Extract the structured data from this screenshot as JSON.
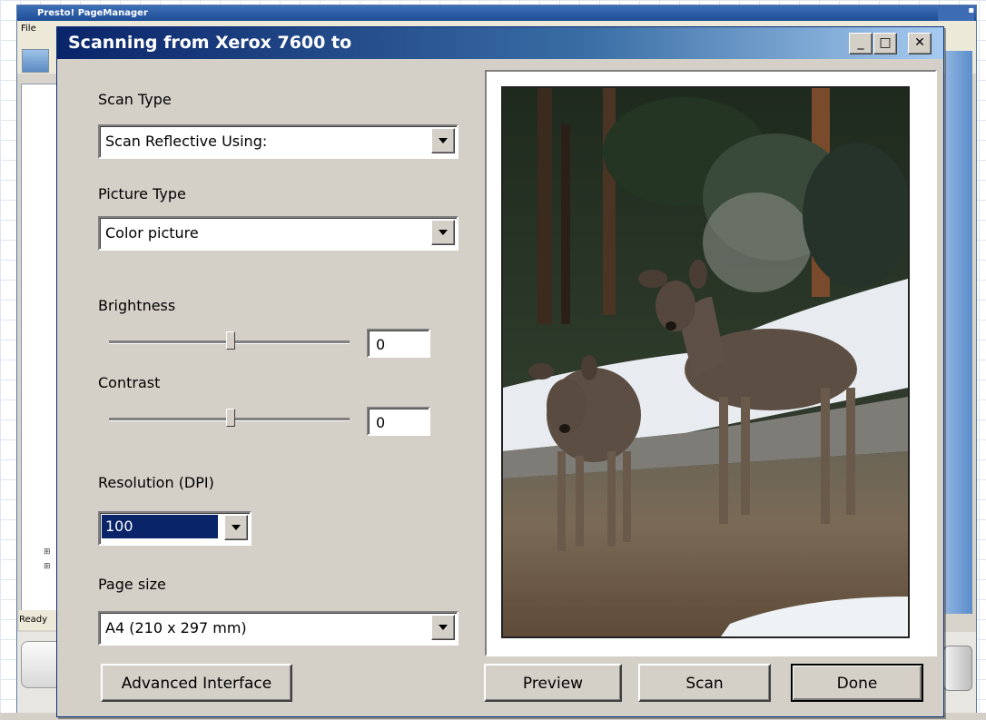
{
  "background_app": {
    "title": "Presto! PageManager",
    "menu": "File",
    "status": "Ready"
  },
  "dialog": {
    "title": "Scanning from Xerox 7600 to",
    "window_buttons": {
      "minimize": "_",
      "maximize": "□",
      "close": "✕"
    },
    "scan_type": {
      "label": "Scan Type",
      "value": "Scan Reflective Using:"
    },
    "picture_type": {
      "label": "Picture Type",
      "value": "Color picture"
    },
    "brightness": {
      "label": "Brightness",
      "value": "0",
      "level": 0.5
    },
    "contrast": {
      "label": "Contrast",
      "value": "0",
      "level": 0.5
    },
    "resolution": {
      "label": "Resolution (DPI)",
      "value": "100"
    },
    "page_size": {
      "label": "Page size",
      "value": "A4 (210 x 297 mm)"
    },
    "buttons": {
      "advanced": "Advanced Interface",
      "preview": "Preview",
      "scan": "Scan",
      "done": "Done"
    },
    "preview_image": "preview-image-two-deer-snow-forest"
  },
  "colors": {
    "title_start": "#0a246a",
    "title_end": "#a6caf0",
    "dialog_face": "#d4d0c8",
    "selection": "#0a246a"
  }
}
